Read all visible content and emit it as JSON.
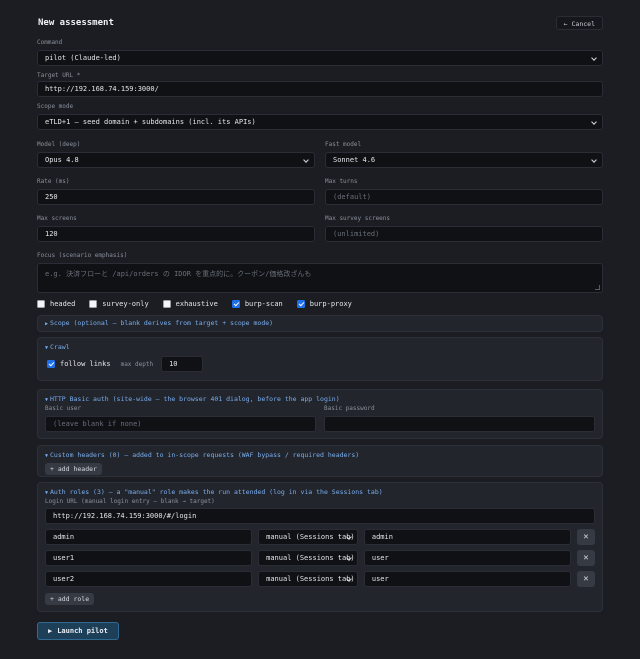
{
  "header": {
    "title": "New assessment",
    "cancel_label": "← Cancel"
  },
  "command": {
    "label": "Command",
    "value": "pilot (Claude-led)"
  },
  "target": {
    "label": "Target URL *",
    "value": "http://192.168.74.159:3000/"
  },
  "scope_mode": {
    "label": "Scope mode",
    "value": "eTLD+1 — seed domain + subdomains (incl. its APIs)"
  },
  "model_deep": {
    "label": "Model (deep)",
    "value": "Opus 4.8"
  },
  "fast_model": {
    "label": "Fast model",
    "value": "Sonnet 4.6"
  },
  "rate": {
    "label": "Rate (ms)",
    "value": "250"
  },
  "max_turns": {
    "label": "Max turns",
    "placeholder": "(default)"
  },
  "max_screens": {
    "label": "Max screens",
    "value": "120"
  },
  "max_survey_screens": {
    "label": "Max survey screens",
    "placeholder": "(unlimited)"
  },
  "focus": {
    "label": "Focus (scenario emphasis)",
    "placeholder": "e.g. 決済フローと /api/orders の IDOR を重点的に。クーポン/価格改ざんも"
  },
  "options": [
    {
      "label": "headed",
      "checked": false
    },
    {
      "label": "survey-only",
      "checked": false
    },
    {
      "label": "exhaustive",
      "checked": false
    },
    {
      "label": "burp-scan",
      "checked": true
    },
    {
      "label": "burp-proxy",
      "checked": true
    }
  ],
  "scope_panel": {
    "title": "Scope (optional — blank derives from target + scope mode)"
  },
  "crawl": {
    "title": "Crawl",
    "follow_links_label": "follow links",
    "follow_links_checked": true,
    "max_depth_label": "max depth",
    "max_depth_value": "10"
  },
  "basic_auth": {
    "title": "HTTP Basic auth (site-wide — the browser 401 dialog, before the app login)",
    "user_label": "Basic user",
    "user_placeholder": "(leave blank if none)",
    "password_label": "Basic password",
    "password_value": ""
  },
  "custom_headers": {
    "title": "Custom headers (0) — added to in-scope requests (WAF bypass / required headers)",
    "add_label": "+ add header"
  },
  "auth_roles": {
    "title": "Auth roles (3) — a \"manual\" role makes the run attended (log in via the Sessions tab)",
    "login_url_label": "Login URL (manual login entry — blank → target)",
    "login_url_value": "http://192.168.74.159:3000/#/login",
    "roles": [
      {
        "name": "admin",
        "mode": "manual (Sessions tab)",
        "role": "admin"
      },
      {
        "name": "user1",
        "mode": "manual (Sessions tab)",
        "role": "user"
      },
      {
        "name": "user2",
        "mode": "manual (Sessions tab)",
        "role": "user"
      }
    ],
    "add_label": "+ add role",
    "remove_glyph": "✕"
  },
  "launch_label": "Launch pilot",
  "colors": {
    "accent": "#79aef0",
    "checkbox_on": "#1f6feb",
    "launch_bg": "#1e3f58",
    "background": "#1b1d23",
    "panel": "#22252c"
  },
  "icons": {
    "collapsed": "triangle-right-icon",
    "expanded": "triangle-down-icon",
    "launch": "play-icon",
    "dropdown": "chevron-down-icon"
  }
}
